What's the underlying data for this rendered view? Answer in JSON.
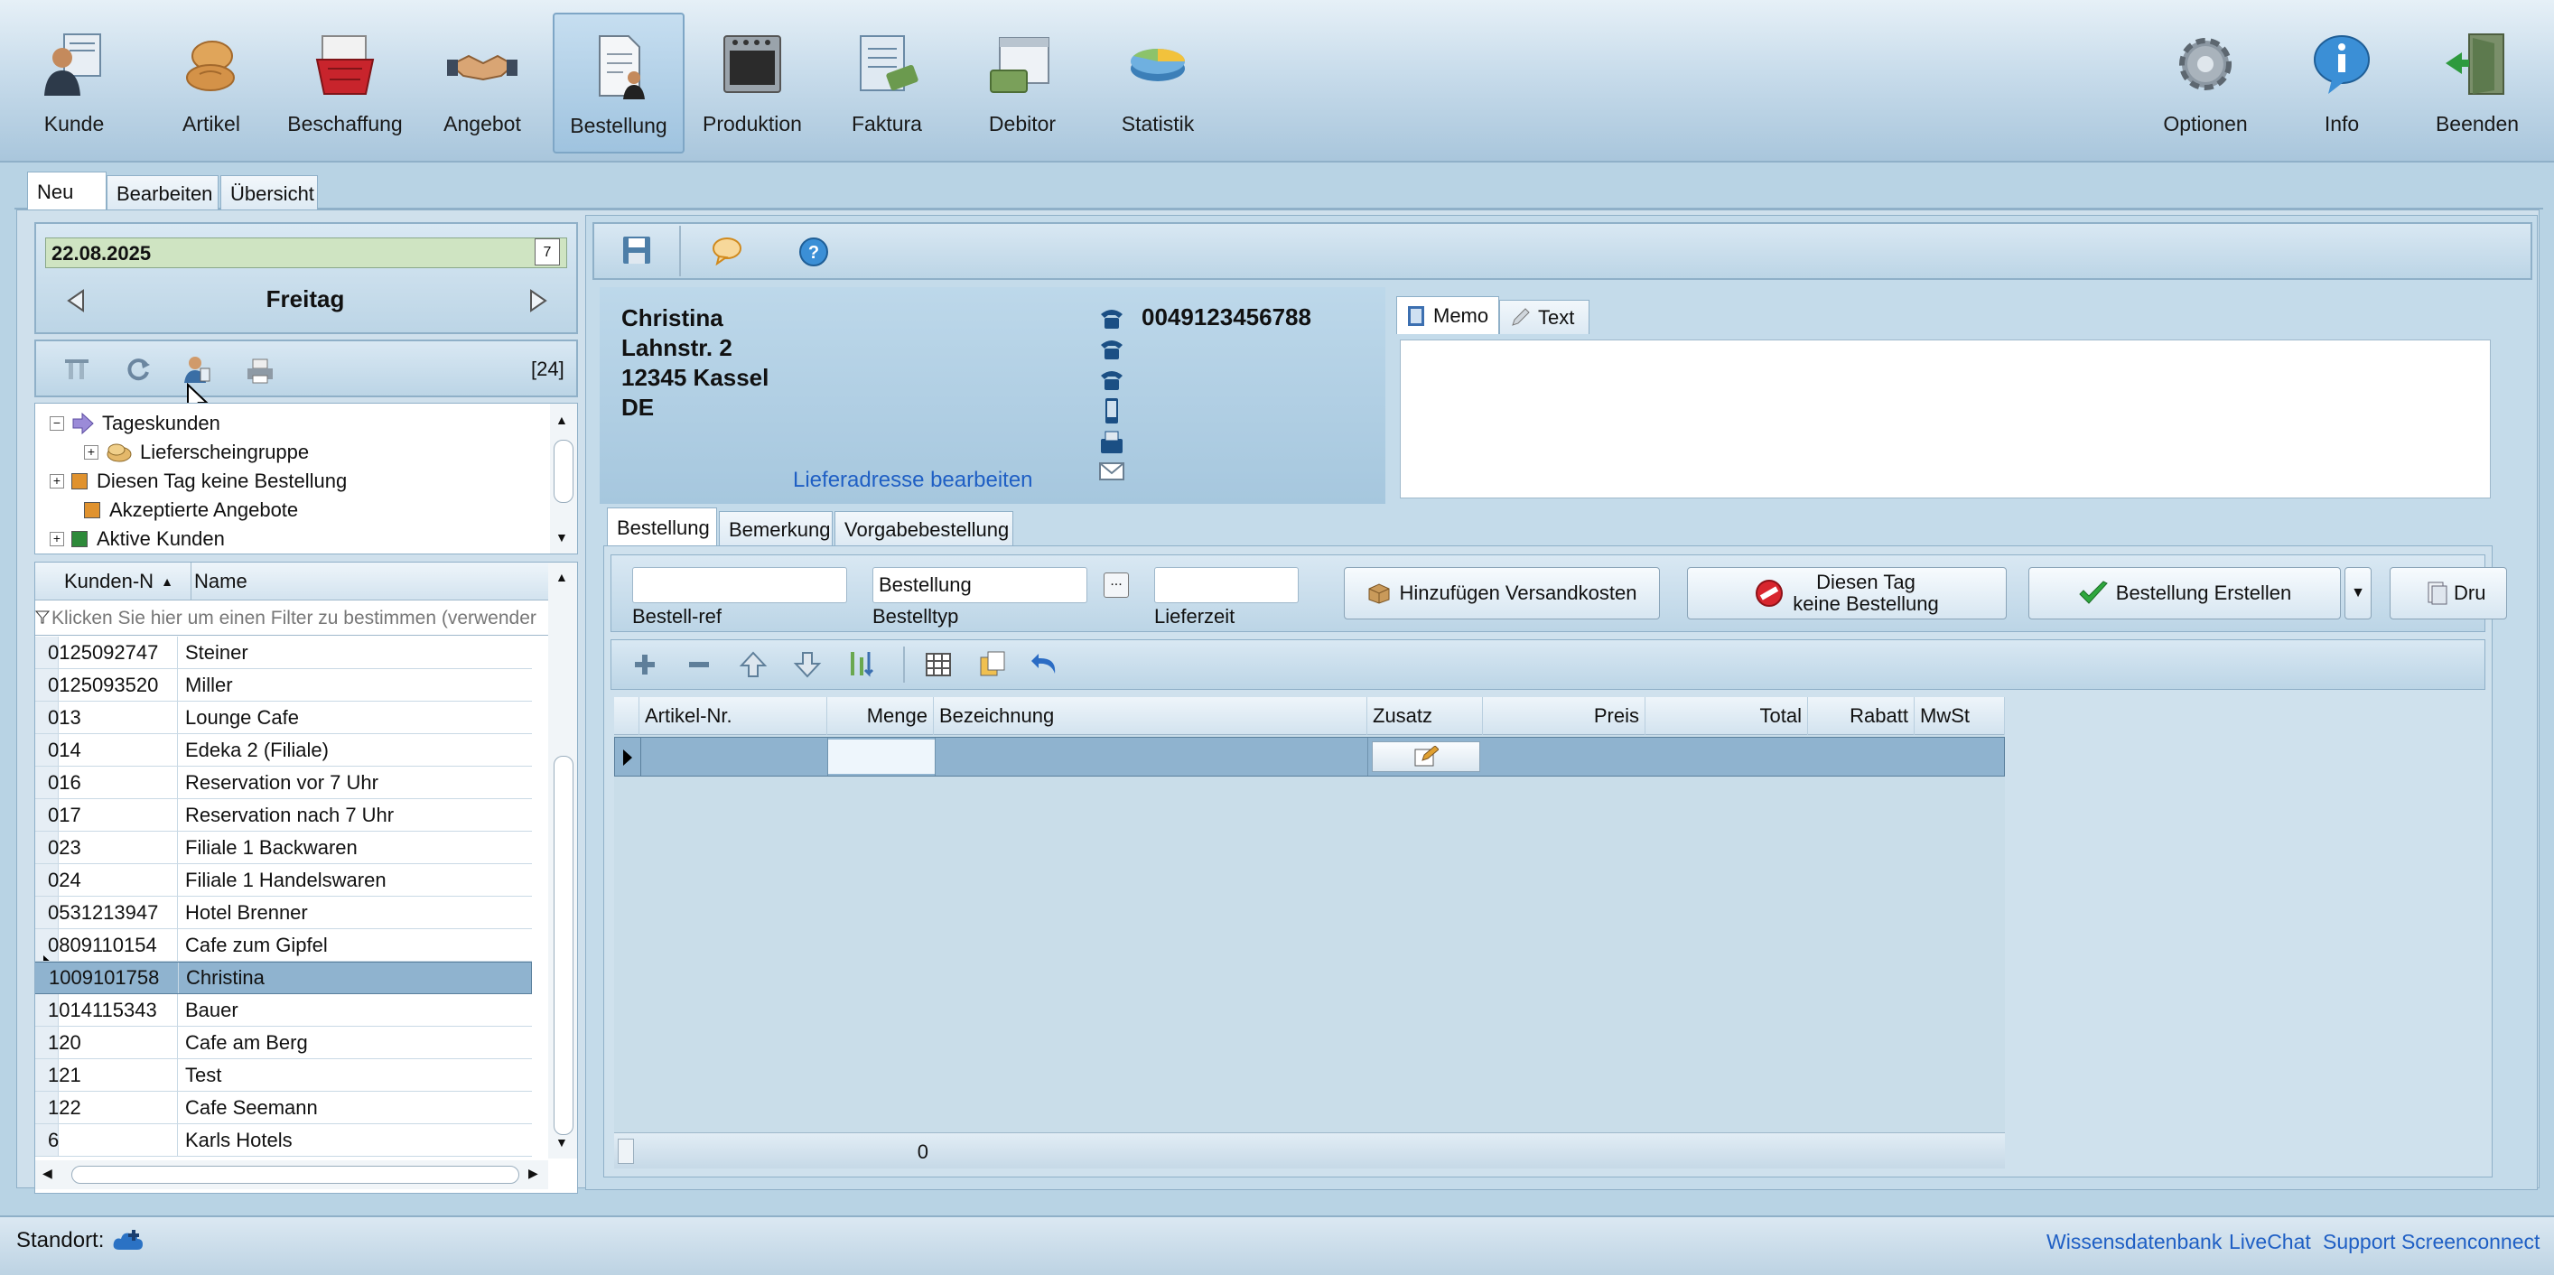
{
  "toolbar": {
    "left": [
      {
        "label": "Kunde",
        "icon": "customer-icon"
      },
      {
        "label": "Artikel",
        "icon": "bread-icon"
      },
      {
        "label": "Beschaffung",
        "icon": "basket-icon"
      },
      {
        "label": "Angebot",
        "icon": "handshake-icon"
      },
      {
        "label": "Bestellung",
        "icon": "order-document-icon"
      },
      {
        "label": "Produktion",
        "icon": "oven-icon"
      },
      {
        "label": "Faktura",
        "icon": "invoice-icon"
      },
      {
        "label": "Debitor",
        "icon": "calendar-money-icon"
      },
      {
        "label": "Statistik",
        "icon": "pie-chart-icon"
      }
    ],
    "right": [
      {
        "label": "Optionen",
        "icon": "gear-icon"
      },
      {
        "label": "Info",
        "icon": "info-icon"
      },
      {
        "label": "Beenden",
        "icon": "exit-door-icon"
      }
    ]
  },
  "main_tabs": [
    "Neu",
    "Bearbeiten",
    "Übersicht"
  ],
  "date_panel": {
    "date": "22.08.2025",
    "weekday": "Freitag",
    "calendar_day": "7"
  },
  "left_toolbar": {
    "count": "[24]"
  },
  "tree": [
    {
      "label": "Tageskunden",
      "icon": "arrow-right-icon"
    },
    {
      "label": "Lieferscheingruppe",
      "icon": "delivery-group-icon"
    },
    {
      "label": "Diesen Tag keine Bestellung",
      "color": "#e0922e"
    },
    {
      "label": "Akzeptierte Angebote",
      "color": "#e0922e"
    },
    {
      "label": "Aktive Kunden",
      "color": "#2e8a3a"
    }
  ],
  "customer_grid": {
    "headers": [
      "Kunden-N",
      "Name"
    ],
    "filter_text": "Klicken Sie hier um einen Filter zu bestimmen (verwender",
    "rows": [
      [
        "0125092747",
        "Steiner"
      ],
      [
        "0125093520",
        "Miller"
      ],
      [
        "013",
        "Lounge Cafe"
      ],
      [
        "014",
        "Edeka 2 (Filiale)"
      ],
      [
        "016",
        "Reservation vor 7 Uhr"
      ],
      [
        "017",
        "Reservation nach 7 Uhr"
      ],
      [
        "023",
        "Filiale 1 Backwaren"
      ],
      [
        "024",
        "Filiale 1 Handelswaren"
      ],
      [
        "0531213947",
        "Hotel Brenner"
      ],
      [
        "0809110154",
        "Cafe zum Gipfel"
      ],
      [
        "1009101758",
        "Christina"
      ],
      [
        "1014115343",
        "Bauer"
      ],
      [
        "120",
        "Cafe am Berg"
      ],
      [
        "121",
        "Test"
      ],
      [
        "122",
        "Cafe Seemann"
      ],
      [
        "6",
        "Karls Hotels"
      ]
    ],
    "selected_index": 10
  },
  "customer": {
    "name": "Christina",
    "street": "Lahnstr. 2",
    "city": "12345 Kassel",
    "country": "DE",
    "phone": "0049123456788",
    "edit_address_link": "Lieferadresse bearbeiten"
  },
  "memo_tabs": [
    "Memo",
    "Text"
  ],
  "order_tabs": [
    "Bestellung",
    "Bemerkung",
    "Vorgabebestellung"
  ],
  "order_form": {
    "ref_label": "Bestell-ref",
    "type_label": "Bestelltyp",
    "type_value": "Bestellung",
    "type_button": "...",
    "delivery_label": "Lieferzeit",
    "shipping_button": "Hinzufügen Versandkosten",
    "no_order_button_line1": "Diesen Tag",
    "no_order_button_line2": "keine Bestellung",
    "create_button": "Bestellung Erstellen",
    "print_button": "Dru"
  },
  "order_grid": {
    "headers": [
      "Artikel-Nr.",
      "Menge",
      "Bezeichnung",
      "Zusatz",
      "Preis",
      "Total",
      "Rabatt",
      "MwSt"
    ],
    "footer_count": "0"
  },
  "status_bar": {
    "standort_label": "Standort:",
    "links": [
      "Wissensdatenbank",
      "LiveChat",
      "Support Screenconnect"
    ]
  },
  "colors": {
    "link": "#1f5fc4",
    "selection": "#8fb3cf",
    "date_bg": "#cfe4c2"
  }
}
